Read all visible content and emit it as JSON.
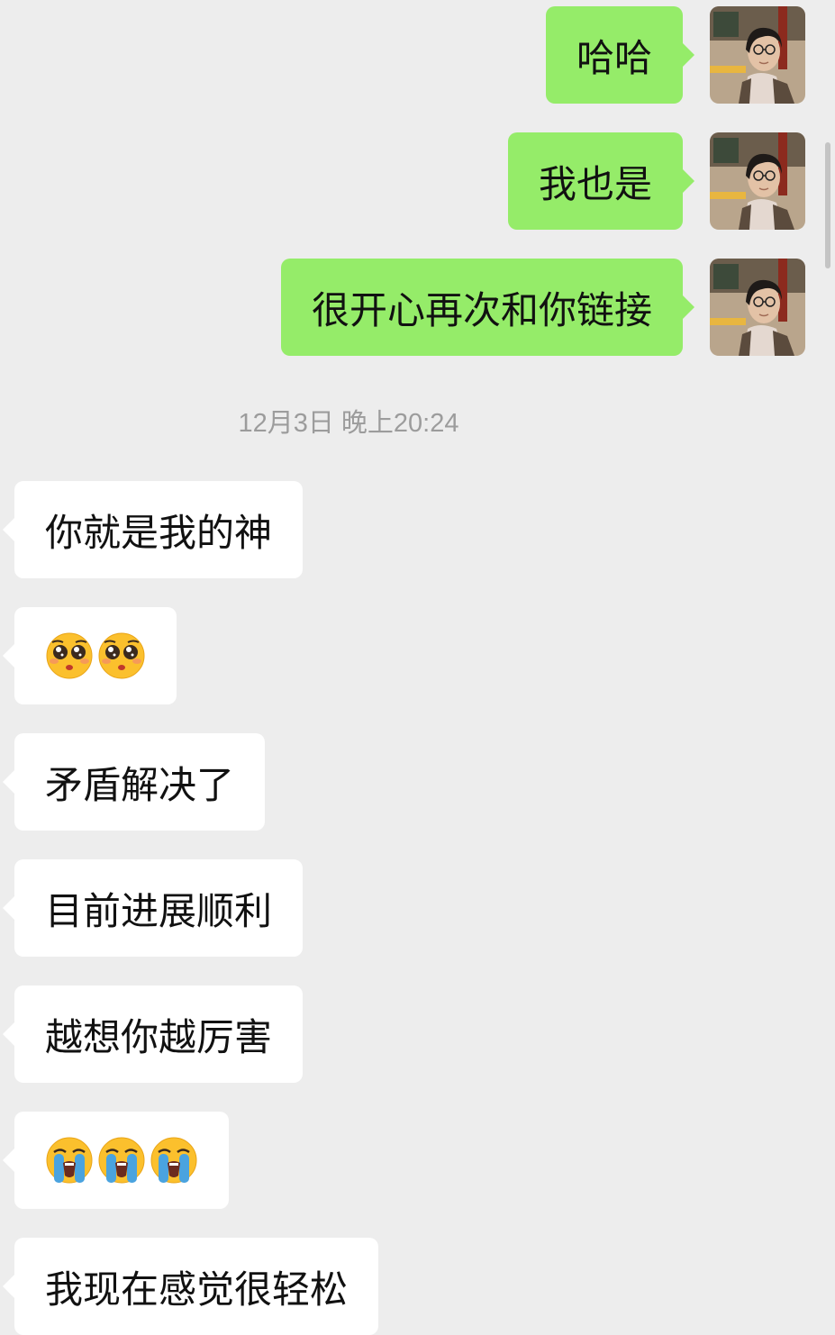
{
  "sent_messages": [
    {
      "text": "哈哈"
    },
    {
      "text": "我也是"
    },
    {
      "text": "很开心再次和你链接"
    }
  ],
  "timestamp": "12月3日 晚上20:24",
  "received_messages": [
    {
      "text": "你就是我的神"
    },
    {
      "emoji": "pleading-face",
      "count": 2
    },
    {
      "text": "矛盾解决了"
    },
    {
      "text": "目前进展顺利"
    },
    {
      "text": "越想你越厉害"
    },
    {
      "emoji": "loudly-crying-face",
      "count": 3
    },
    {
      "text": "我现在感觉很轻松"
    }
  ],
  "colors": {
    "background": "#ededed",
    "sent_bubble": "#95ec69",
    "received_bubble": "#ffffff",
    "timestamp_text": "#9c9c9c"
  }
}
